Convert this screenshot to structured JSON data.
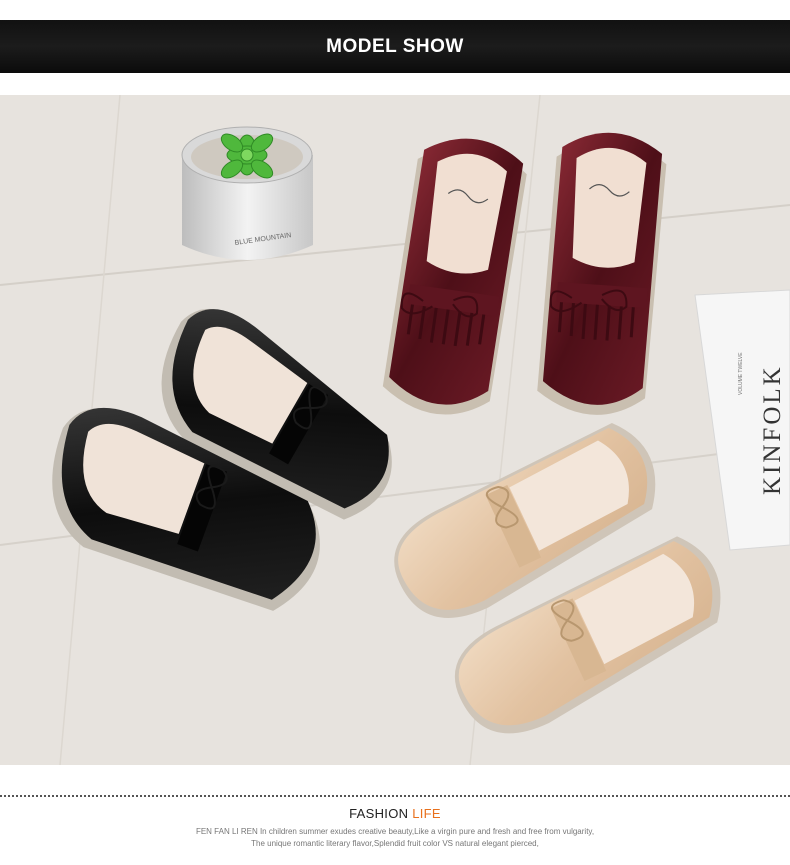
{
  "header": {
    "title": "MODEL SHOW"
  },
  "photo": {
    "plant_label": "BLUE MOUNTAIN",
    "magazine_title": "KINFOLK",
    "magazine_subtitle": "VOLUME TWELVE"
  },
  "footer": {
    "title_main": "FASHION",
    "title_accent": "LIFE",
    "line1": "FEN FAN LI REN  In children summer exudes creative beauty,Like a virgin pure and fresh and free from vulgarity,",
    "line2": "The unique romantic literary flavor,Splendid fruit color VS natural elegant pierced,"
  },
  "colors": {
    "accent": "#e8701c",
    "banner_bg": "#111111",
    "floor": "#e7e3de"
  }
}
